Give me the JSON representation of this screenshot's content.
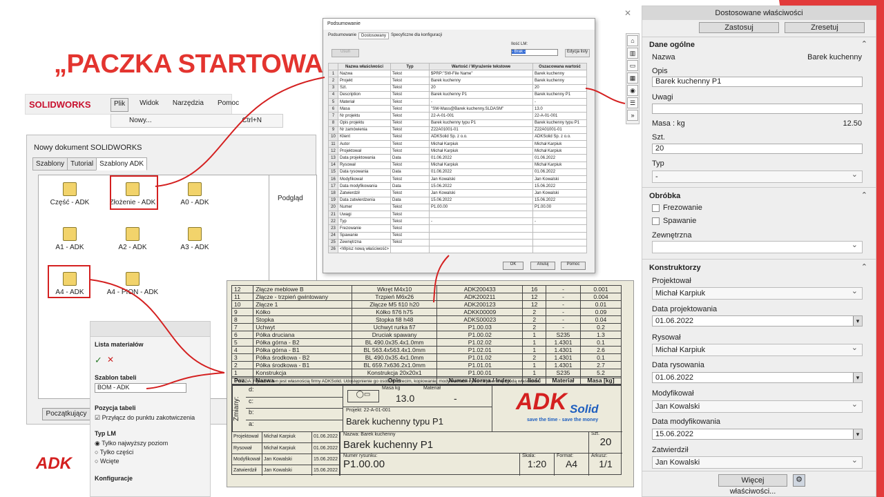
{
  "slide": {
    "title": "„PACZKA STARTOWA”"
  },
  "solidworks": {
    "logo": "SOLIDWORKS",
    "menu": [
      "Plik",
      "Widok",
      "Narzędzia",
      "Pomoc"
    ],
    "new_item": "Nowy...",
    "new_shortcut": "Ctrl+N"
  },
  "newdoc": {
    "title": "Nowy dokument SOLIDWORKS",
    "tabs": [
      "Szablony",
      "Tutorial",
      "Szablony ADK"
    ],
    "templates": [
      "Część - ADK",
      "Złożenie - ADK",
      "A0 - ADK",
      "A1 - ADK",
      "A2 - ADK",
      "A3 - ADK",
      "A4 - ADK",
      "A4 - PION - ADK"
    ],
    "preview_label": "Podgląd",
    "start_button": "Początkujący"
  },
  "bom_panel": {
    "title": "Lista materiałów",
    "table_template_label": "Szablon tabeli",
    "table_template_value": "BOM - ADK",
    "position_label": "Pozycja tabeli",
    "attach_label": "Przyłącz do punktu zakotwiczenia",
    "type_label": "Typ LM",
    "type_options": [
      "Tylko najwyższy poziom",
      "Tylko części",
      "Wcięte"
    ],
    "config_label": "Konfiguracje"
  },
  "summary": {
    "title": "Podsumowanie",
    "tabs": [
      "Podsumowanie",
      "Dostosowany",
      "Specyficzne dla konfiguracji"
    ],
    "delete_button": "Usuń",
    "qty_label": "Ilość LM:",
    "qty_value": "- Brak -",
    "edit_list_button": "Edycja listy",
    "headers": [
      "Nazwa właściwości",
      "Typ",
      "Wartość / Wyrażenie tekstowe",
      "Oszacowana wartość"
    ],
    "rows": [
      [
        "1",
        "Nazwa",
        "Tekst",
        "$PRP:\"SW-File Name\"",
        "Barek kuchenny"
      ],
      [
        "2",
        "Projekt",
        "Tekst",
        "Barek kuchenny",
        "Barek kuchenny"
      ],
      [
        "3",
        "Szt.",
        "Tekst",
        "20",
        "20"
      ],
      [
        "4",
        "Description",
        "Tekst",
        "Barek kuchenny P1",
        "Barek kuchenny P1"
      ],
      [
        "5",
        "Materiał",
        "Tekst",
        "-",
        "-"
      ],
      [
        "6",
        "Masa",
        "Tekst",
        "\"SW-Mass@Barek kuchenny.SLDASM\"",
        "13.0"
      ],
      [
        "7",
        "Nr projektu",
        "Tekst",
        "22-A-01-001",
        "22-A-01-001"
      ],
      [
        "8",
        "Opis projektu",
        "Tekst",
        "Barek kuchenny typu P1",
        "Barek kuchenny typu P1"
      ],
      [
        "9",
        "Nr zamówienia",
        "Tekst",
        "Z22A01001-01",
        "Z22A01001-01"
      ],
      [
        "10",
        "Klient",
        "Tekst",
        "ADKSolid Sp. z o.o.",
        "ADKSolid Sp. z o.o."
      ],
      [
        "11",
        "Autor",
        "Tekst",
        "Michał Karpiuk",
        "Michał Karpiuk"
      ],
      [
        "12",
        "Projektował",
        "Tekst",
        "Michał Karpiuk",
        "Michał Karpiuk"
      ],
      [
        "13",
        "Data projektowania",
        "Data",
        "01.06.2022",
        "01.06.2022"
      ],
      [
        "14",
        "Rysował",
        "Tekst",
        "Michał Karpiuk",
        "Michał Karpiuk"
      ],
      [
        "15",
        "Data rysowania",
        "Data",
        "01.06.2022",
        "01.06.2022"
      ],
      [
        "16",
        "Modyfikował",
        "Tekst",
        "Jan Kowalski",
        "Jan Kowalski"
      ],
      [
        "17",
        "Data modyfikowania",
        "Data",
        "15.06.2022",
        "15.06.2022"
      ],
      [
        "18",
        "Zatwierdził",
        "Tekst",
        "Jan Kowalski",
        "Jan Kowalski"
      ],
      [
        "19",
        "Data zatwierdzenia",
        "Data",
        "15.06.2022",
        "15.06.2022"
      ],
      [
        "20",
        "Numer",
        "Tekst",
        "P1.00.00",
        "P1.00.00"
      ],
      [
        "21",
        "Uwagi",
        "Tekst",
        "",
        ""
      ],
      [
        "22",
        "Typ",
        "Tekst",
        "-",
        "-"
      ],
      [
        "23",
        "Frezowanie",
        "Tekst",
        "",
        ""
      ],
      [
        "24",
        "Spawanie",
        "Tekst",
        "",
        ""
      ],
      [
        "25",
        "Zewnętrzna",
        "Tekst",
        "",
        ""
      ],
      [
        "26",
        "<Wpisz nową właściwość>",
        "",
        "",
        ""
      ]
    ],
    "ok": "OK",
    "cancel": "Anuluj",
    "help": "Pomoc"
  },
  "drawing": {
    "bom_rows": [
      [
        "12",
        "Złącze meblowe B",
        "Wkręt M4x10",
        "ADK200433",
        "16",
        "-",
        "0.001"
      ],
      [
        "11",
        "Złącze - trzpień gwintowany",
        "Trzpień M6x26",
        "ADK200211",
        "12",
        "-",
        "0.004"
      ],
      [
        "10",
        "Złącze 1",
        "Złącze M5 fi10 h20",
        "ADK200123",
        "12",
        "-",
        "0.01"
      ],
      [
        "9",
        "Kółko",
        "Kółko fi76 h75",
        "ADKK00009",
        "2",
        "-",
        "0.09"
      ],
      [
        "8",
        "Stopka",
        "Stopka fi8 h48",
        "ADKS00023",
        "2",
        "-",
        "0.04"
      ],
      [
        "7",
        "Uchwyt",
        "Uchwyt rurka fi7",
        "P1.00.03",
        "2",
        "-",
        "0.2"
      ],
      [
        "6",
        "Półka druciana",
        "Druciak spawany",
        "P1.00.02",
        "1",
        "S235",
        "1.3"
      ],
      [
        "5",
        "Półka górna - B2",
        "BL 490.0x35.4x1.0mm",
        "P1.02.02",
        "1",
        "1.4301",
        "0.1"
      ],
      [
        "4",
        "Półka górna - B1",
        "BL 563.4x563.4x1.0mm",
        "P1.02.01",
        "1",
        "1.4301",
        "2.6"
      ],
      [
        "3",
        "Półka środkowa - B2",
        "BL 490.0x35.4x1.0mm",
        "P1.01.02",
        "2",
        "1.4301",
        "0.1"
      ],
      [
        "2",
        "Półka środkowa - B1",
        "BL 659.7x636.2x1.0mm",
        "P1.01.01",
        "1",
        "1.4301",
        "2.7"
      ],
      [
        "1",
        "Konstrukcja",
        "Konstrukcja 20x20x1",
        "P1.00.01",
        "1",
        "S235",
        "5.2"
      ]
    ],
    "bom_header": [
      "Poz.",
      "Nazwa",
      "Opis",
      "Numer / Norma / Index",
      "Ilość",
      "Materiał",
      "Masa [kg]"
    ],
    "note": "UWAGA: Rysunek ten jest własnością firmy ADKSolid. Udostępnienie go osobom trzecim, kopiowanie, modyfikowanie tylko za pisemną zgodą właściciela",
    "changes_label": "Zmiany:",
    "changes": [
      "d:",
      "c:",
      "b:",
      "a:"
    ],
    "mass_label": "Masa kg",
    "mass_value": "13.0",
    "material_label": "Materiał",
    "material_value": "-",
    "project_label": "Projekt: 22-A-01-001",
    "project_value": "Barek kuchenny typu P1",
    "name_label": "Nazwa: Barek kuchenny",
    "name_value": "Barek kuchenny P1",
    "qty_label": "Szt.",
    "qty_value": "20",
    "drawing_no_label": "Numer rysunku:",
    "drawing_no": "P1.00.00",
    "scale_label": "Skala:",
    "scale_value": "1:20",
    "format_label": "Format:",
    "format_value": "A4",
    "sheet_label": "Arkusz:",
    "sheet_value": "1/1",
    "people": [
      [
        "Projektował",
        "Michał Karpiuk",
        "01.06.2022"
      ],
      [
        "Rysował",
        "Michał Karpiuk",
        "01.06.2022"
      ],
      [
        "Modyfikował",
        "Jan Kowalski",
        "15.06.2022"
      ],
      [
        "Zatwierdził",
        "Jan Kowalski",
        "15.06.2022"
      ]
    ],
    "logo": "ADK",
    "logo_sub": "Solid",
    "slogan": "save the time - save the money"
  },
  "right_panel": {
    "title": "Dostosowane właściwości",
    "apply": "Zastosuj",
    "reset": "Zresetuj",
    "general": "Dane ogólne",
    "name_label": "Nazwa",
    "name_value": "Barek kuchenny",
    "desc_label": "Opis",
    "desc_value": "Barek kuchenny P1",
    "notes_label": "Uwagi",
    "mass_label": "Masa : kg",
    "mass_value": "12.50",
    "qty_label": "Szt.",
    "qty_value": "20",
    "type_label": "Typ",
    "type_value": "-",
    "processing": "Obróbka",
    "milling": "Frezowanie",
    "welding": "Spawanie",
    "external": "Zewnętrzna",
    "designers": "Konstruktorzy",
    "designed_by_label": "Projektował",
    "designed_by": "Michał Karpiuk",
    "design_date_label": "Data projektowania",
    "design_date": "01.06.2022",
    "drawn_by_label": "Rysował",
    "drawn_by": "Michał Karpiuk",
    "draw_date_label": "Data rysowania",
    "draw_date": "01.06.2022",
    "modified_by_label": "Modyfikował",
    "modified_by": "Jan Kowalski",
    "mod_date_label": "Data modyfikowania",
    "mod_date": "15.06.2022",
    "approved_label": "Zatwierdził",
    "approved_by": "Jan Kowalski",
    "more_button": "Więcej właściwości..."
  },
  "colors": {
    "accent_red": "#e3342f",
    "logo_red": "#d42020",
    "logo_blue": "#1f5fbf",
    "logo_orange": "#f5a11a"
  }
}
